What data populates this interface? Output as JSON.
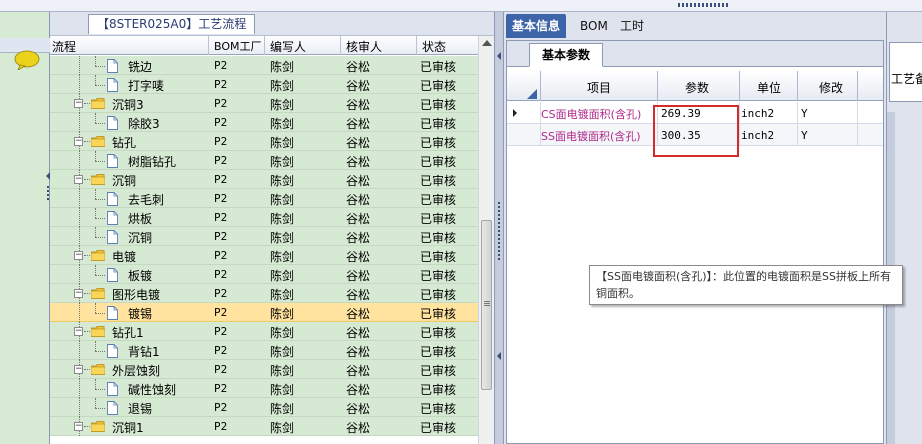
{
  "left_panel": {
    "icons": [
      "chat-bubble-icon"
    ]
  },
  "process_panel": {
    "title": "【8STER025A0】工艺流程",
    "columns": {
      "process": "流程",
      "bom_factory": "BOM工厂",
      "writer": "编写人",
      "reviewer": "核审人",
      "status": "状态"
    },
    "rows": [
      {
        "indent": 2,
        "kind": "doc",
        "name": "铣边",
        "factory": "P2",
        "writer": "陈剑",
        "reviewer": "谷松",
        "status": "已审核"
      },
      {
        "indent": 2,
        "kind": "doc",
        "name": "打字唛",
        "factory": "P2",
        "writer": "陈剑",
        "reviewer": "谷松",
        "status": "已审核"
      },
      {
        "indent": 1,
        "kind": "folder",
        "name": "沉铜3",
        "factory": "P2",
        "writer": "陈剑",
        "reviewer": "谷松",
        "status": "已审核"
      },
      {
        "indent": 2,
        "kind": "doc",
        "name": "除胶3",
        "factory": "P2",
        "writer": "陈剑",
        "reviewer": "谷松",
        "status": "已审核"
      },
      {
        "indent": 1,
        "kind": "folder",
        "name": "钻孔",
        "factory": "P2",
        "writer": "陈剑",
        "reviewer": "谷松",
        "status": "已审核"
      },
      {
        "indent": 2,
        "kind": "doc",
        "name": "树脂钻孔",
        "factory": "P2",
        "writer": "陈剑",
        "reviewer": "谷松",
        "status": "已审核"
      },
      {
        "indent": 1,
        "kind": "folder",
        "name": "沉铜",
        "factory": "P2",
        "writer": "陈剑",
        "reviewer": "谷松",
        "status": "已审核"
      },
      {
        "indent": 2,
        "kind": "doc",
        "name": "去毛刺",
        "factory": "P2",
        "writer": "陈剑",
        "reviewer": "谷松",
        "status": "已审核"
      },
      {
        "indent": 2,
        "kind": "doc",
        "name": "烘板",
        "factory": "P2",
        "writer": "陈剑",
        "reviewer": "谷松",
        "status": "已审核"
      },
      {
        "indent": 2,
        "kind": "doc",
        "name": "沉铜",
        "factory": "P2",
        "writer": "陈剑",
        "reviewer": "谷松",
        "status": "已审核"
      },
      {
        "indent": 1,
        "kind": "folder",
        "name": "电镀",
        "factory": "P2",
        "writer": "陈剑",
        "reviewer": "谷松",
        "status": "已审核"
      },
      {
        "indent": 2,
        "kind": "doc",
        "name": "板镀",
        "factory": "P2",
        "writer": "陈剑",
        "reviewer": "谷松",
        "status": "已审核"
      },
      {
        "indent": 1,
        "kind": "folder",
        "name": "图形电镀",
        "factory": "P2",
        "writer": "陈剑",
        "reviewer": "谷松",
        "status": "已审核"
      },
      {
        "indent": 2,
        "kind": "doc",
        "name": "镀锡",
        "factory": "P2",
        "writer": "陈剑",
        "reviewer": "谷松",
        "status": "已审核",
        "selected": true
      },
      {
        "indent": 1,
        "kind": "folder",
        "name": "钻孔1",
        "factory": "P2",
        "writer": "陈剑",
        "reviewer": "谷松",
        "status": "已审核"
      },
      {
        "indent": 2,
        "kind": "doc",
        "name": "背钻1",
        "factory": "P2",
        "writer": "陈剑",
        "reviewer": "谷松",
        "status": "已审核"
      },
      {
        "indent": 1,
        "kind": "folder",
        "name": "外层蚀刻",
        "factory": "P2",
        "writer": "陈剑",
        "reviewer": "谷松",
        "status": "已审核"
      },
      {
        "indent": 2,
        "kind": "doc",
        "name": "碱性蚀刻",
        "factory": "P2",
        "writer": "陈剑",
        "reviewer": "谷松",
        "status": "已审核"
      },
      {
        "indent": 2,
        "kind": "doc",
        "name": "退锡",
        "factory": "P2",
        "writer": "陈剑",
        "reviewer": "谷松",
        "status": "已审核"
      },
      {
        "indent": 1,
        "kind": "folder",
        "name": "沉铜1",
        "factory": "P2",
        "writer": "陈剑",
        "reviewer": "谷松",
        "status": "已审核"
      }
    ]
  },
  "detail_panel": {
    "tabs": [
      "基本信息",
      "BOM",
      "工时"
    ],
    "active_tab": 0,
    "subtab": "基本参数",
    "columns": {
      "item": "项目",
      "param": "参数",
      "unit": "单位",
      "modify": "修改"
    },
    "rows": [
      {
        "item": "CS面电镀面积(含孔)",
        "param": "269.39",
        "unit": "inch2",
        "modify": "Y"
      },
      {
        "item": "SS面电镀面积(含孔)",
        "param": "300.35",
        "unit": "inch2",
        "modify": "Y"
      }
    ],
    "tooltip": "【SS面电镀面积(含孔)】：此位置的电镀面积是SS拼板上所有铜面积。"
  },
  "far_right": {
    "label": "工艺备"
  },
  "colors": {
    "row_green": "#d6ead3",
    "row_selected": "#ffe39e",
    "tab_active": "#3d63a8",
    "highlight_box": "#d52a2a",
    "item_text": "#b0298b"
  }
}
